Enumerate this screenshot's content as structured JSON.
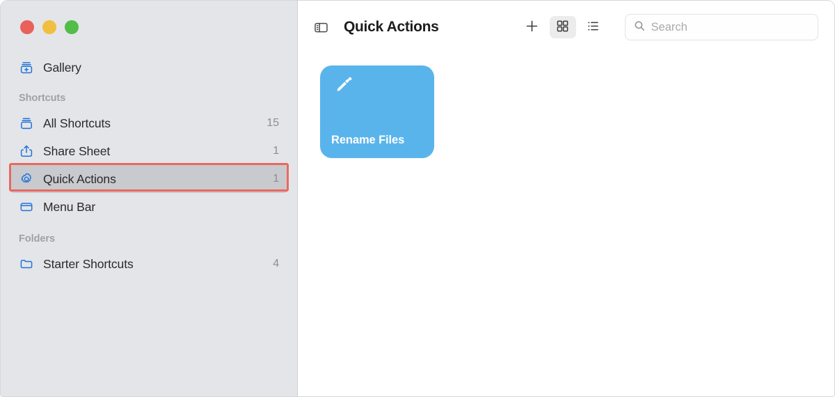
{
  "window": {
    "traffic_lights": [
      {
        "name": "close",
        "color": "#e8615a"
      },
      {
        "name": "minimize",
        "color": "#f0bf3f"
      },
      {
        "name": "zoom",
        "color": "#52bd49"
      }
    ]
  },
  "sidebar": {
    "top_items": [
      {
        "label": "Gallery",
        "icon": "gallery-icon",
        "count": ""
      }
    ],
    "sections": [
      {
        "title": "Shortcuts",
        "items": [
          {
            "label": "All Shortcuts",
            "icon": "all-shortcuts-icon",
            "count": "15",
            "selected": false
          },
          {
            "label": "Share Sheet",
            "icon": "share-sheet-icon",
            "count": "1",
            "selected": false
          },
          {
            "label": "Quick Actions",
            "icon": "gear-icon",
            "count": "1",
            "selected": true
          },
          {
            "label": "Menu Bar",
            "icon": "menu-bar-icon",
            "count": "",
            "selected": false
          }
        ]
      },
      {
        "title": "Folders",
        "items": [
          {
            "label": "Starter Shortcuts",
            "icon": "folder-icon",
            "count": "4",
            "selected": false
          }
        ]
      }
    ],
    "annotation": {
      "target": "Quick Actions",
      "color": "#e8695f"
    }
  },
  "toolbar": {
    "sidebar_toggle": "sidebar-toggle-icon",
    "title": "Quick Actions",
    "add_button": "plus-icon",
    "grid_view_button": "grid-view-icon",
    "list_view_button": "list-view-icon",
    "active_view": "grid",
    "search": {
      "icon": "search-icon",
      "value": "",
      "placeholder": "Search"
    }
  },
  "main": {
    "cards": [
      {
        "title": "Rename Files",
        "icon": "magic-wand-icon",
        "color": "#5ab4ec"
      }
    ]
  }
}
